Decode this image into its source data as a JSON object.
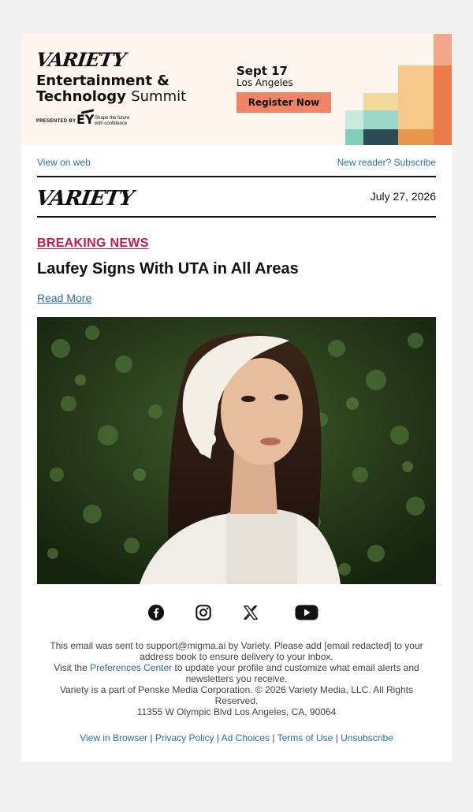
{
  "banner": {
    "logo": "VARIETY",
    "title_line1": "Entertainment &",
    "title_line2_bold": "Technology",
    "title_line2_light": "Summit",
    "presented_by": "PRESENTED BY",
    "sponsor": "EY",
    "sponsor_tagline_1": "Shape the future",
    "sponsor_tagline_2": "with confidence",
    "date": "Sept 17",
    "location": "Los Angeles",
    "cta_label": "Register Now",
    "colors": {
      "background": "#fdf5ee",
      "cta": "#f08466"
    }
  },
  "header": {
    "view_on_web": "View on web",
    "subscribe": "New reader? Subscribe",
    "logo": "VARIETY",
    "date": "July 27, 2026"
  },
  "article": {
    "kicker": "BREAKING NEWS",
    "headline": "Laufey Signs With UTA in All Areas",
    "read_more": "Read More",
    "kicker_color": "#c8194a"
  },
  "social": [
    {
      "name": "facebook-icon"
    },
    {
      "name": "instagram-icon"
    },
    {
      "name": "x-icon"
    },
    {
      "name": "youtube-icon"
    }
  ],
  "footer": {
    "line1": "This email was sent to support@migma.ai by Variety. Please add [email redacted] to your address book to ensure delivery to your inbox.",
    "visit_prefix": "Visit the ",
    "preferences": "Preferences Center",
    "visit_suffix": " to update your profile and customize what email alerts and newsletters you receive.",
    "corp": "Variety is a part of Penske Media Corporation. © 2026 Variety Media, LLC. All Rights Reserved.",
    "address": "11355 W Olympic Blvd Los Angeles, CA, 90064",
    "links": {
      "browser": "View in Browser",
      "privacy": "Privacy Policy",
      "ad": "Ad Choices",
      "terms": "Terms of Use",
      "unsubscribe": "Unsubscribe",
      "separator": "|"
    }
  }
}
